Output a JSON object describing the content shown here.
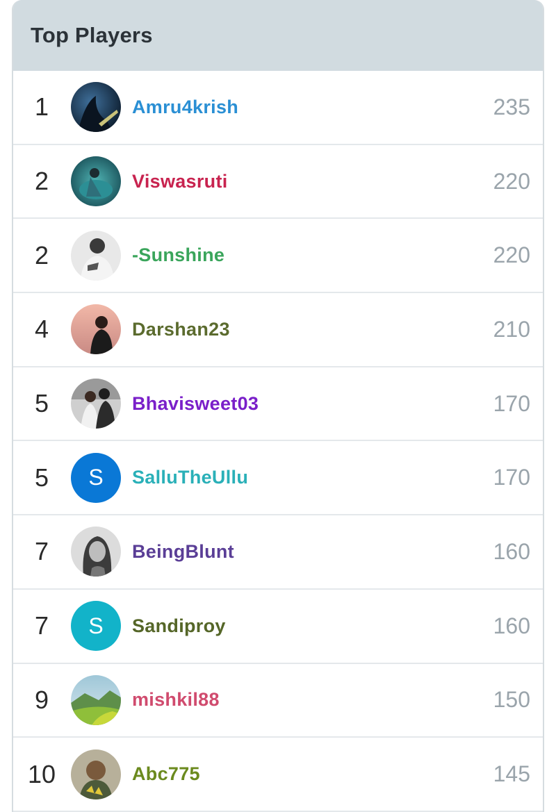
{
  "title": "Top Players",
  "players": [
    {
      "rank": "1",
      "name": "Amru4krish",
      "score": "235",
      "name_color": "#2a8fd4",
      "avatar": "photo-icon"
    },
    {
      "rank": "2",
      "name": "Viswasruti",
      "score": "220",
      "name_color": "#c8234f",
      "avatar": "photo-icon"
    },
    {
      "rank": "2",
      "name": "-Sunshine",
      "score": "220",
      "name_color": "#3aa55b",
      "avatar": "photo-icon"
    },
    {
      "rank": "4",
      "name": "Darshan23",
      "score": "210",
      "name_color": "#5b6b2e",
      "avatar": "photo-icon"
    },
    {
      "rank": "5",
      "name": "Bhavisweet03",
      "score": "170",
      "name_color": "#7a1fc9",
      "avatar": "photo-icon"
    },
    {
      "rank": "5",
      "name": "SalluTheUllu",
      "score": "170",
      "name_color": "#2ab0b8",
      "avatar": "letter",
      "letter": "S",
      "avatar_color": "#0a78d6"
    },
    {
      "rank": "7",
      "name": "BeingBlunt",
      "score": "160",
      "name_color": "#5a3e96",
      "avatar": "photo-icon"
    },
    {
      "rank": "7",
      "name": "Sandiproy",
      "score": "160",
      "name_color": "#556628",
      "avatar": "letter",
      "letter": "S",
      "avatar_color": "#12b3c9"
    },
    {
      "rank": "9",
      "name": "mishkil88",
      "score": "150",
      "name_color": "#d04b6e",
      "avatar": "photo-icon"
    },
    {
      "rank": "10",
      "name": "Abc775",
      "score": "145",
      "name_color": "#6b8a1e",
      "avatar": "photo-icon"
    }
  ]
}
